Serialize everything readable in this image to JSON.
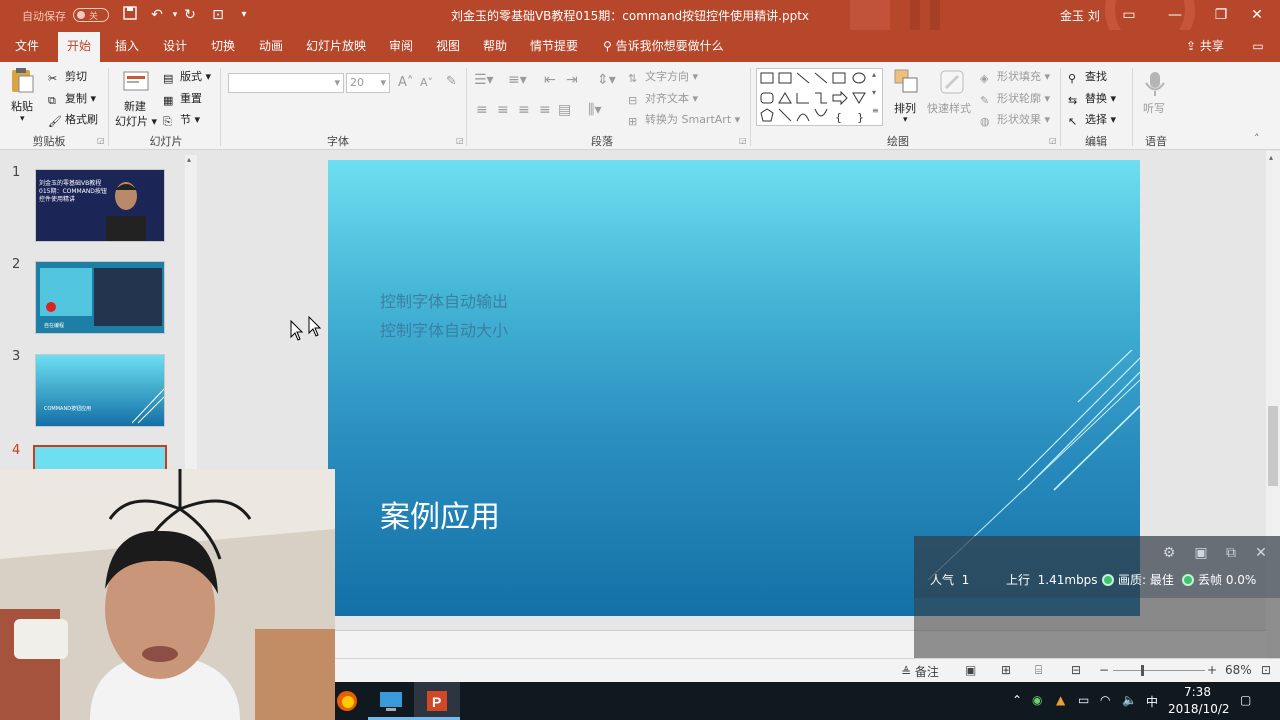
{
  "titlebar": {
    "autosave_label": "自动保存",
    "autosave_state": "关",
    "document_title": "刘金玉的零基础VB教程015期：command按钮控件使用精讲.pptx",
    "user": "金玉 刘"
  },
  "tabs": [
    "文件",
    "开始",
    "插入",
    "设计",
    "切换",
    "动画",
    "幻灯片放映",
    "审阅",
    "视图",
    "帮助",
    "情节提要"
  ],
  "active_tab": "开始",
  "tell_me": "告诉我你想要做什么",
  "share": "共享",
  "ribbon": {
    "clipboard": {
      "paste": "粘贴",
      "cut": "剪切",
      "copy": "复制",
      "format_painter": "格式刷",
      "label": "剪贴板"
    },
    "slides": {
      "new_slide_1": "新建",
      "new_slide_2": "幻灯片",
      "layout": "版式",
      "reset": "重置",
      "section": "节",
      "label": "幻灯片"
    },
    "font": {
      "font_size": "20",
      "label": "字体"
    },
    "paragraph": {
      "text_direction": "文字方向",
      "align_text": "对齐文本",
      "smartart": "转换为 SmartArt",
      "label": "段落"
    },
    "drawing": {
      "arrange": "排列",
      "quick_styles": "快速样式",
      "shape_fill": "形状填充",
      "shape_outline": "形状轮廓",
      "shape_effects": "形状效果",
      "label": "绘图"
    },
    "editing": {
      "find": "查找",
      "replace": "替换",
      "select": "选择",
      "label": "编辑"
    },
    "voice": {
      "dictate": "听写",
      "label": "语音"
    }
  },
  "slides_pane": {
    "numbers": [
      "1",
      "2",
      "3",
      "4"
    ],
    "thumb1_text": "刘金玉的零基础VB教程015期：COMMAND按钮控件使用精讲",
    "thumb2_text": "自在编程",
    "thumb3_text": "COMMAND按钮应用"
  },
  "slide": {
    "line1": "控制字体自动输出",
    "line2": "控制字体自动大小",
    "heading": "案例应用"
  },
  "overlay": {
    "viewers_label": "人气",
    "viewers": "1",
    "upload_label": "上行",
    "upload": "1.41mbps",
    "quality": "画质: 最佳",
    "drop": "丢帧 0.0%"
  },
  "statusbar": {
    "notes": "备注",
    "zoom": "68%"
  },
  "taskbar": {
    "ime": "中",
    "time": "7:38",
    "date": "2018/10/2"
  },
  "colors": {
    "accent": "#b7472a",
    "slide_top": "#6ddff0",
    "slide_bottom": "#1470a6",
    "taskbar": "#101820"
  }
}
